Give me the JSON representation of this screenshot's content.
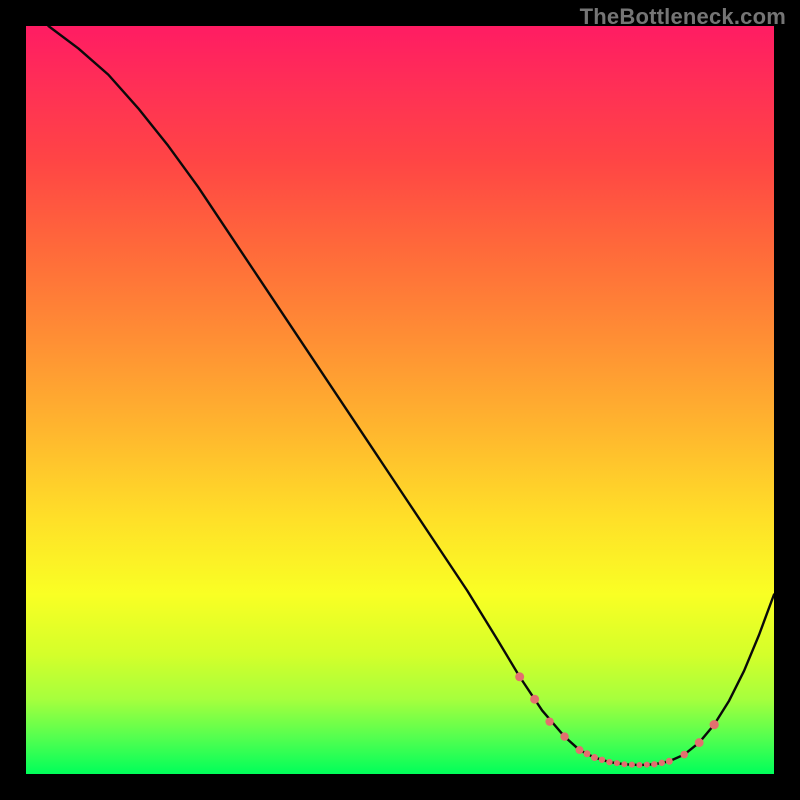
{
  "brand": "TheBottleneck.com",
  "colors": {
    "page_bg": "#000000",
    "curve": "#0a0a0a",
    "marker": "#e36f6f"
  },
  "chart_data": {
    "type": "line",
    "title": "",
    "xlabel": "",
    "ylabel": "",
    "xlim": [
      0,
      100
    ],
    "ylim": [
      0,
      100
    ],
    "grid": false,
    "legend": false,
    "series": [
      {
        "name": "bottleneck-curve",
        "x": [
          3,
          7,
          11,
          15,
          19,
          23,
          27,
          31,
          35,
          39,
          43,
          47,
          51,
          55,
          59,
          63,
          66,
          69,
          72,
          74,
          76,
          78,
          80,
          82,
          84,
          86,
          88,
          90,
          92,
          94,
          96,
          98,
          100
        ],
        "y": [
          100,
          97,
          93.5,
          89,
          84,
          78.5,
          72.5,
          66.5,
          60.5,
          54.5,
          48.5,
          42.5,
          36.5,
          30.5,
          24.5,
          18,
          13,
          8.5,
          5,
          3.2,
          2.2,
          1.6,
          1.3,
          1.2,
          1.3,
          1.7,
          2.6,
          4.2,
          6.6,
          9.8,
          13.8,
          18.6,
          24
        ]
      }
    ],
    "markers": {
      "name": "highlighted-region",
      "x": [
        66,
        68,
        70,
        72,
        74,
        75,
        76,
        77,
        78,
        79,
        80,
        81,
        82,
        83,
        84,
        85,
        86,
        88,
        90,
        92
      ],
      "y": [
        13,
        10,
        7,
        5,
        3.2,
        2.7,
        2.2,
        1.9,
        1.6,
        1.45,
        1.3,
        1.25,
        1.2,
        1.25,
        1.3,
        1.5,
        1.7,
        2.6,
        4.2,
        6.6
      ],
      "r": [
        4.5,
        4.5,
        4.2,
        4.2,
        4.0,
        3.5,
        3.5,
        3.2,
        3.2,
        3.0,
        3.0,
        3.0,
        3.0,
        3.0,
        3.2,
        3.2,
        3.5,
        3.8,
        4.4,
        4.6
      ]
    }
  }
}
